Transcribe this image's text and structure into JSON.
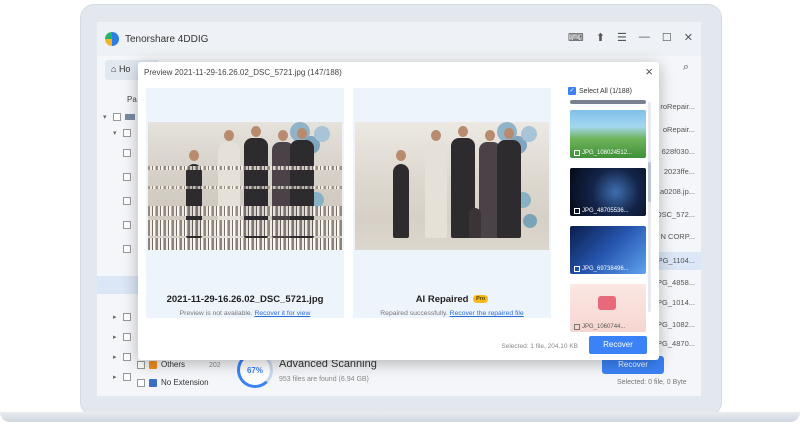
{
  "app": {
    "title": "Tenorshare 4DDIG",
    "nav_label": "Ho",
    "window_controls": [
      "⌨",
      "⬆",
      "☰",
      "—",
      "☐",
      "✕"
    ]
  },
  "tree": {
    "header": "Pa",
    "others_label": "Others",
    "others_count": "202",
    "no_extension_label": "No Extension"
  },
  "right_list": [
    "roRepair...",
    "oRepair...",
    "628f030...",
    "2023ffe...",
    "a0208.jp...",
    "DSC_572...",
    "N CORP...",
    "IPG_1104...",
    "IPG_4858...",
    "IPG_1014...",
    "IPG_1082...",
    "IPG_4870..."
  ],
  "scan": {
    "percent": "67%",
    "title": "Advanced Scanning",
    "files_found": "953 files are found (6.94 GB)"
  },
  "bg_recover_label": "Recover",
  "bg_selected": "Selected: 0 file, 0 Byte",
  "preview": {
    "title": "Preview  2021-11-29-16.26.02_DSC_5721.jpg (147/188)",
    "left": {
      "filename": "2021-11-29-16.26.02_DSC_5721.jpg",
      "status": "Preview is not available.",
      "link": "Recover it for view"
    },
    "right": {
      "title": "AI Repaired",
      "badge": "Pro",
      "status": "Repaired successfully.",
      "link": "Recover the repaired file"
    },
    "select_all": "Select All (1/188)",
    "thumbnails": [
      {
        "label": "JPG_108024512...",
        "scene": "landscape"
      },
      {
        "label": "JPG_48705536...",
        "scene": "space"
      },
      {
        "label": "JPG_69738496...",
        "scene": "tech"
      },
      {
        "label": "JPG_1060744...",
        "scene": "product"
      }
    ],
    "selected_info": "Selected: 1 file, 204.10 KB",
    "recover_label": "Recover"
  },
  "colors": {
    "accent": "#3b82f6",
    "pro_badge": "#f6b91b"
  }
}
